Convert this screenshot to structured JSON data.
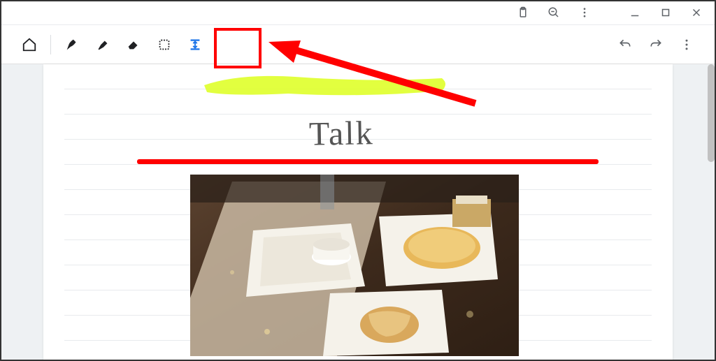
{
  "titlebar": {
    "icons": [
      "clipboard",
      "zoom-out",
      "more-vert",
      "minimize",
      "maximize",
      "close"
    ]
  },
  "toolbar": {
    "home": "home",
    "tools": [
      "pen",
      "highlighter",
      "eraser",
      "select",
      "expand"
    ],
    "right": [
      "undo",
      "redo",
      "more-vert"
    ]
  },
  "canvas": {
    "handwritten_text": "Talk",
    "highlight_color": "#dfff00",
    "underline_color": "#ff0000"
  },
  "annotation": {
    "highlighted_tool_index": 4,
    "highlight_box_color": "#ff0000"
  }
}
